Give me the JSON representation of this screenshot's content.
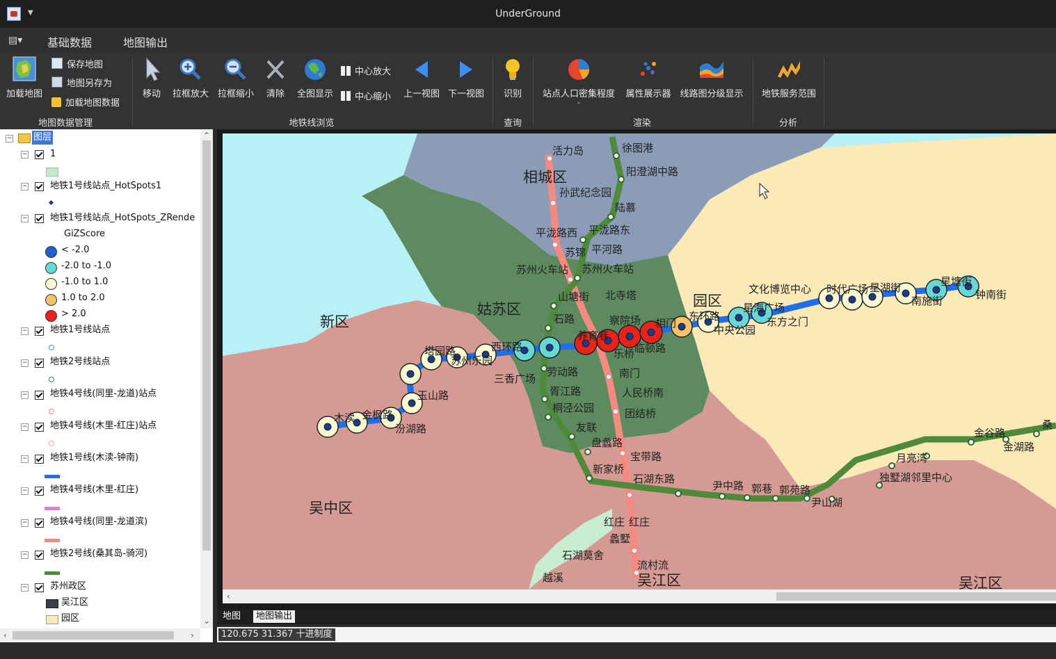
{
  "window": {
    "title": "UnderGround"
  },
  "menu": {
    "tabs": [
      "基础数据",
      "地图输出"
    ]
  },
  "ribbon": {
    "buttons": {
      "load_map": "加载地图",
      "save_map": "保存地图",
      "save_as": "地图另存为",
      "load_data": "加载地图数据",
      "move": "移动",
      "zoom_in_box": "拉框放大",
      "zoom_out_box": "拉框缩小",
      "clear": "清除",
      "full_extent": "全图显示",
      "center_zoom_in": "中心放大",
      "center_zoom_out": "中心缩小",
      "prev_view": "上一视图",
      "next_view": "下一视图",
      "identify": "识别",
      "density": "站点人口密集程度",
      "attr_viewer": "属性展示器",
      "line_class": "线路图分级显示",
      "service_area": "地铁服务范围"
    },
    "groups": [
      "地图数据管理",
      "地铁线浏览",
      "查询",
      "渲染",
      "分析"
    ]
  },
  "toc": {
    "root": "图层",
    "layer_1": "1",
    "hotspots1": "地铁1号线站点_HotSpots1",
    "hotspots_z": "地铁1号线站点_HotSpots_ZRende",
    "gi_field": "GiZScore",
    "gi_classes": [
      {
        "label": "< -2.0",
        "color": "#1f5fd6"
      },
      {
        "label": "-2.0 to -1.0",
        "color": "#67d8d6"
      },
      {
        "label": "-1.0 to 1.0",
        "color": "#fafad2"
      },
      {
        "label": "1.0 to 2.0",
        "color": "#f5c26b"
      },
      {
        "label": "> 2.0",
        "color": "#e8231c"
      }
    ],
    "layers": [
      "地铁1号线站点",
      "地铁2号线站点",
      "地铁4号线(同里-龙道)站点",
      "地铁4号线(木里-红庄)站点",
      "地铁1号线(木渎-钟南)",
      "地铁4号线(木里-红庄)",
      "地铁4号线(同里-龙道滨)",
      "地铁2号线(桑其岛-骑河)",
      "苏州政区"
    ],
    "district_classes": [
      "吴江区",
      "园区"
    ]
  },
  "map": {
    "districts": [
      "相城区",
      "姑苏区",
      "新区",
      "园区",
      "吴中区",
      "吴江区",
      "吴江区"
    ],
    "stations": [
      "活力岛",
      "徐图港",
      "阳澄湖中路",
      "孙武纪念园",
      "陆慕",
      "平泷路西",
      "平泷路东",
      "苏锦",
      "平河路",
      "苏州火车站",
      "苏州火车站",
      "山塘街",
      "北寺塔",
      "石路",
      "察院场",
      "相门",
      "东环路",
      "中央公园",
      "星海广场",
      "东方之门",
      "文化博览中心",
      "时代广场",
      "星湖街",
      "南施街",
      "星塘街",
      "钟南街",
      "塔园路",
      "西环路",
      "养育巷",
      "乐桥",
      "临顿路",
      "三香广场",
      "劳动路",
      "胥江路",
      "桐泾公园",
      "友联",
      "盘蠡路",
      "新家桥",
      "石湖东路",
      "宝带路",
      "南门",
      "人民桥南",
      "团结桥",
      "尹中路",
      "郭巷",
      "郭苑路",
      "尹山湖",
      "月亮湾",
      "独墅湖邻里中心",
      "金谷路",
      "金湖路",
      "桑",
      "红庄",
      "红庄",
      "蠡墅",
      "石湖莫舍",
      "越溪",
      "流村流",
      "玉山路",
      "汾湖路",
      "金枫路",
      "木渎",
      "苏州乐园"
    ]
  },
  "bottom_tabs": [
    "地图",
    "地图输出"
  ],
  "status": {
    "coords": "120.675 31.367 十进制度"
  }
}
